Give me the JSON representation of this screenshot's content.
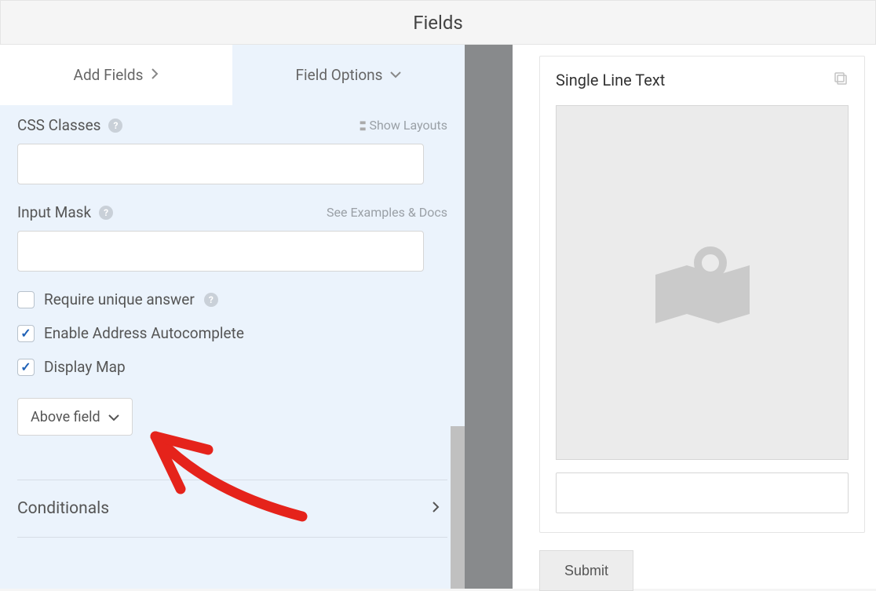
{
  "header": {
    "title": "Fields"
  },
  "tabs": {
    "add_fields": "Add Fields",
    "field_options": "Field Options"
  },
  "options": {
    "css_classes": {
      "label": "CSS Classes",
      "show_layouts": "Show Layouts",
      "value": ""
    },
    "input_mask": {
      "label": "Input Mask",
      "examples_link": "See Examples & Docs",
      "value": ""
    },
    "require_unique": {
      "label": "Require unique answer",
      "checked": false
    },
    "address_autocomplete": {
      "label": "Enable Address Autocomplete",
      "checked": true
    },
    "display_map": {
      "label": "Display Map",
      "checked": true,
      "position": "Above field"
    },
    "conditionals": {
      "label": "Conditionals"
    }
  },
  "preview": {
    "field_title": "Single Line Text",
    "submit": "Submit"
  }
}
